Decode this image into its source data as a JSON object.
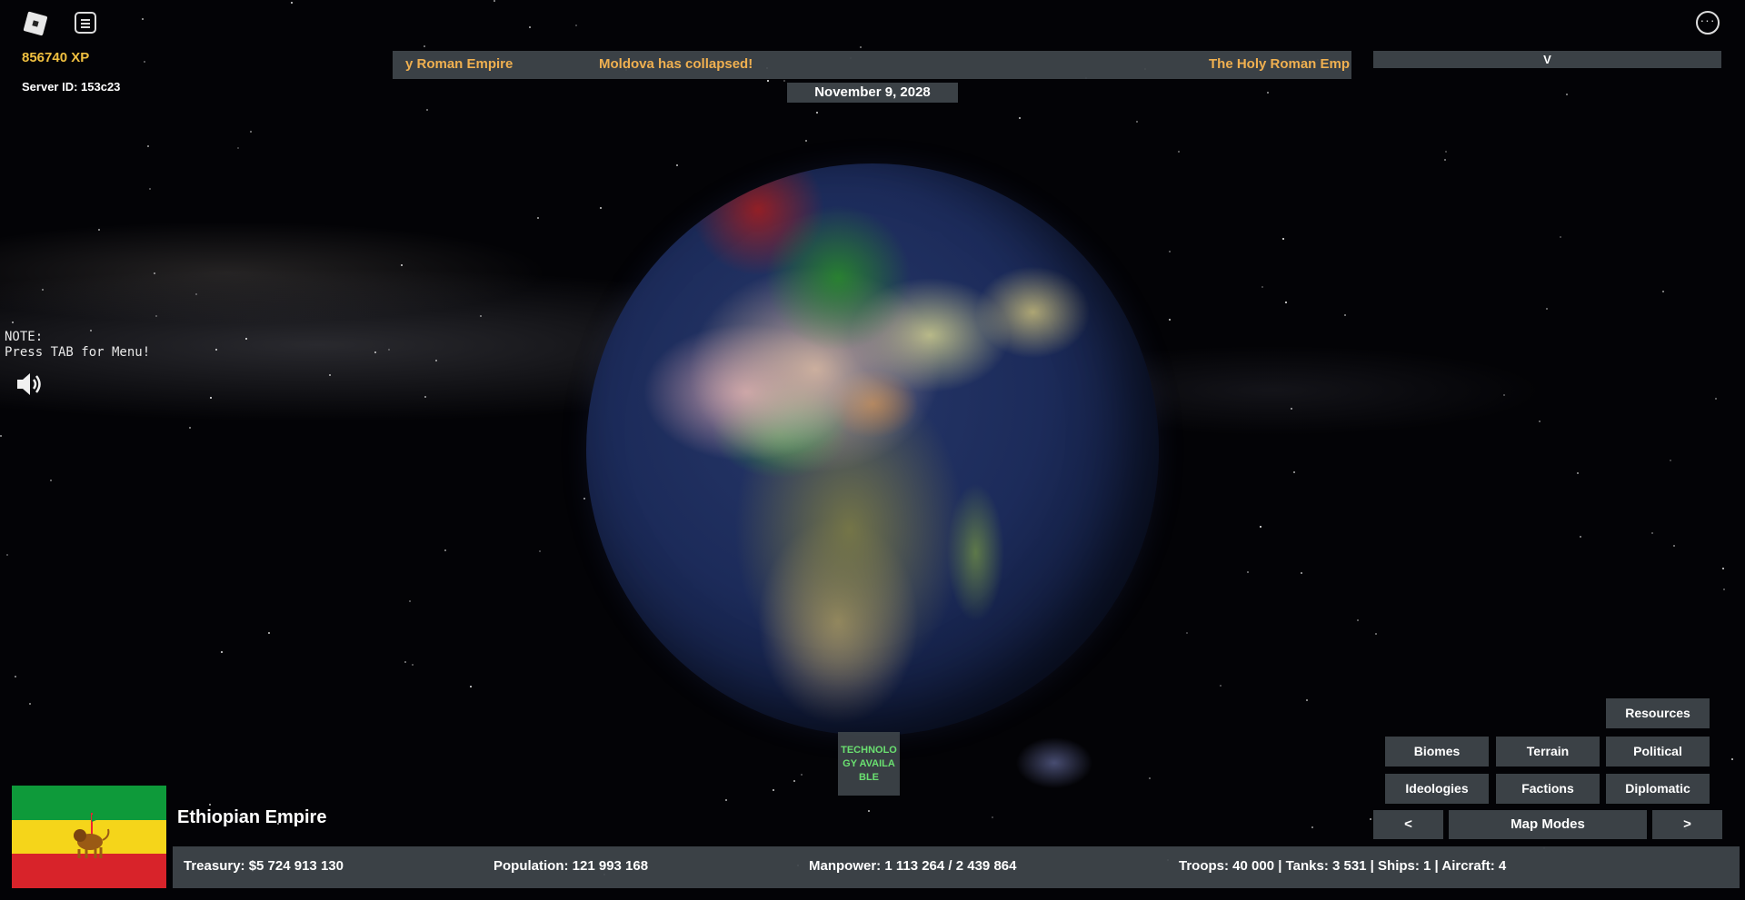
{
  "hud": {
    "xp": "856740 XP",
    "server_id": "Server ID: 153c23",
    "note": "NOTE:\nPress TAB for Menu!"
  },
  "ticker": {
    "items": [
      "y Roman Empire",
      "Moldova has collapsed!",
      "The Holy Roman Emp"
    ]
  },
  "date": "November 9, 2028",
  "top_right_bar": "V",
  "technology_button": "TECHNOLOGY AVAILABLE",
  "map_modes": {
    "resources": "Resources",
    "biomes": "Biomes",
    "terrain": "Terrain",
    "political": "Political",
    "ideologies": "Ideologies",
    "factions": "Factions",
    "diplomatic": "Diplomatic",
    "prev": "<",
    "label": "Map Modes",
    "next": ">"
  },
  "country": {
    "name": "Ethiopian Empire",
    "flag_colors": [
      "#0e9a3a",
      "#f5d51a",
      "#d8232a"
    ]
  },
  "stats": {
    "treasury": "Treasury:  $5 724 913 130",
    "population": "Population: 121 993 168",
    "manpower": "Manpower:  1 113 264  /  2 439 864",
    "military": "Troops: 40 000  |  Tanks: 3 531  |  Ships: 1  |  Aircraft: 4"
  },
  "icons": [
    "roblox-logo-icon",
    "chat-menu-icon",
    "more-options-icon",
    "speaker-icon",
    "lion-emblem-icon"
  ]
}
